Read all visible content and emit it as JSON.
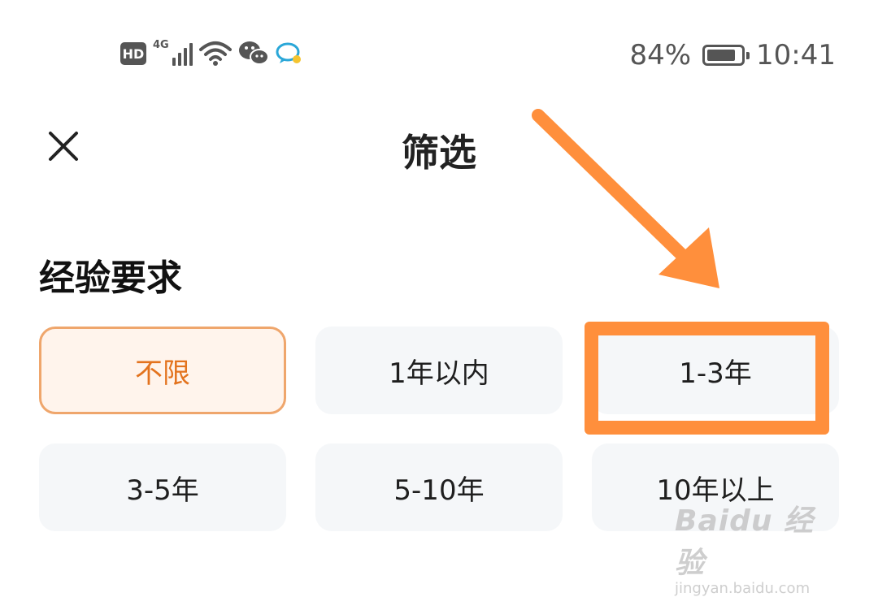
{
  "status_bar": {
    "hd_label": "HD",
    "network_label": "4G",
    "battery_level": 0.84,
    "battery_text": "84%",
    "time": "10:41",
    "icons": [
      "hd-icon",
      "signal-icon",
      "wifi-icon",
      "wechat-icon",
      "message-icon",
      "battery-icon"
    ]
  },
  "header": {
    "title": "筛选",
    "close_icon": "close-icon"
  },
  "experience": {
    "section_title": "经验要求",
    "options": [
      {
        "label": "不限",
        "selected": true
      },
      {
        "label": "1年以内",
        "selected": false
      },
      {
        "label": "1-3年",
        "selected": false
      },
      {
        "label": "3-5年",
        "selected": false
      },
      {
        "label": "5-10年",
        "selected": false
      },
      {
        "label": "10年以上",
        "selected": false
      }
    ]
  },
  "annotation": {
    "color": "#ff8f3c",
    "target_option": "1-3年"
  },
  "watermark": {
    "main": "Baidu 经验",
    "sub": "jingyan.baidu.com"
  },
  "colors": {
    "selected_text": "#e3731e",
    "selected_border": "#efa66c",
    "selected_bg": "#fff4ec",
    "chip_bg": "#f5f7f9"
  }
}
